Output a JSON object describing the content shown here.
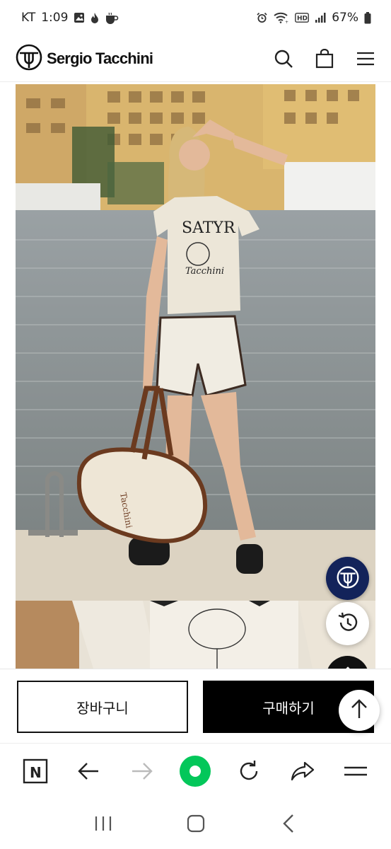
{
  "status_bar": {
    "carrier": "KT",
    "time": "1:09",
    "battery": "67%",
    "icons_left": [
      "gallery-icon",
      "fire-icon",
      "coffee-icon"
    ],
    "icons_right": [
      "alarm-icon",
      "wifi-icon",
      "hd-icon",
      "signal-icon",
      "battery-icon"
    ]
  },
  "header": {
    "brand": "Sergio Tacchini",
    "icons": [
      "search-icon",
      "shopping-bag-icon",
      "hamburger-menu-icon"
    ]
  },
  "hero": {
    "tshirt_print_top": "SATYR",
    "tshirt_print_script": "Tacchini",
    "bag_print": "Tacchini"
  },
  "purchase": {
    "cart_label": "장바구니",
    "buy_label": "구매하기"
  },
  "browser_toolbar": {
    "n_label": "N",
    "icons": [
      "naver-home-icon",
      "back-arrow-icon",
      "forward-arrow-icon",
      "green-dot-icon",
      "reload-icon",
      "share-icon",
      "menu-icon"
    ]
  },
  "system_nav": {
    "icons": [
      "recent-apps-icon",
      "home-icon",
      "back-icon"
    ]
  },
  "colors": {
    "fab_brand": "#13235a",
    "buy_button": "#000000",
    "green_dot": "#03c75a"
  }
}
